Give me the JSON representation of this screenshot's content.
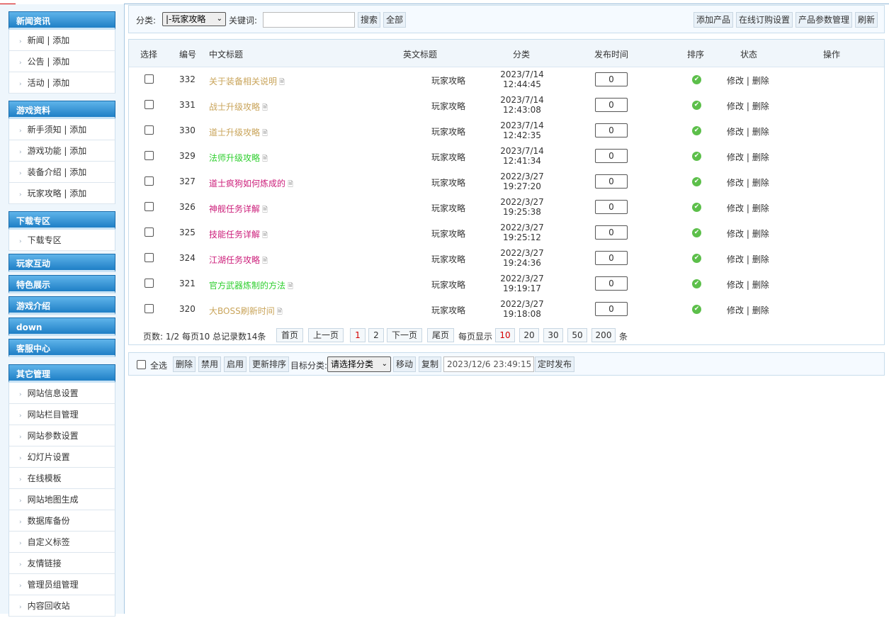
{
  "sidebar": {
    "groups": [
      {
        "title": "新闻资讯",
        "items": [
          "新闻 | 添加",
          "公告 | 添加",
          "活动 | 添加"
        ]
      },
      {
        "title": "游戏资料",
        "items": [
          "新手须知 | 添加",
          "游戏功能 | 添加",
          "装备介绍 | 添加",
          "玩家攻略 | 添加"
        ]
      },
      {
        "title": "下载专区",
        "items": [
          "下载专区"
        ]
      },
      {
        "title": "玩家互动",
        "items": []
      },
      {
        "title": "特色展示",
        "items": []
      },
      {
        "title": "游戏介绍",
        "items": []
      },
      {
        "title": "down",
        "items": []
      },
      {
        "title": "客服中心",
        "items": []
      },
      {
        "title": "其它管理",
        "items": [
          "网站信息设置",
          "网站栏目管理",
          "网站参数设置",
          "幻灯片设置",
          "在线模板",
          "网站地图生成",
          "数据库备份",
          "自定义标签",
          "友情链接",
          "管理员组管理",
          "内容回收站"
        ]
      }
    ]
  },
  "toolbar": {
    "category_label": "分类:",
    "category_value": "|-玩家攻略",
    "keyword_label": "关键词:",
    "keyword_value": "",
    "search_label": "搜索",
    "all_label": "全部",
    "add_product": "添加产品",
    "online_order": "在线订购设置",
    "product_params": "产品参数管理",
    "refresh": "刷新"
  },
  "table": {
    "headers": [
      "选择",
      "编号",
      "中文标题",
      "英文标题",
      "分类",
      "发布时间",
      "排序",
      "状态",
      "操作"
    ],
    "rows": [
      {
        "id": "332",
        "title": "关于装备相关说明",
        "title_color": "#c9a45a",
        "category": "玩家攻略",
        "date": "2023/7/14",
        "time": "12:44:45",
        "order": "0",
        "edit": "修改",
        "del": "删除"
      },
      {
        "id": "331",
        "title": "战士升级攻略",
        "title_color": "#c9a45a",
        "category": "玩家攻略",
        "date": "2023/7/14",
        "time": "12:43:08",
        "order": "0",
        "edit": "修改",
        "del": "删除"
      },
      {
        "id": "330",
        "title": "道士升级攻略",
        "title_color": "#c9a45a",
        "category": "玩家攻略",
        "date": "2023/7/14",
        "time": "12:42:35",
        "order": "0",
        "edit": "修改",
        "del": "删除"
      },
      {
        "id": "329",
        "title": "法师升级攻略",
        "title_color": "#2fcf2f",
        "category": "玩家攻略",
        "date": "2023/7/14",
        "time": "12:41:34",
        "order": "0",
        "edit": "修改",
        "del": "删除"
      },
      {
        "id": "327",
        "title": "道士疯狗如何炼成的",
        "title_color": "#cc1e7a",
        "category": "玩家攻略",
        "date": "2022/3/27",
        "time": "19:27:20",
        "order": "0",
        "edit": "修改",
        "del": "删除"
      },
      {
        "id": "326",
        "title": "神舰任务详解",
        "title_color": "#cc1e7a",
        "category": "玩家攻略",
        "date": "2022/3/27",
        "time": "19:25:38",
        "order": "0",
        "edit": "修改",
        "del": "删除"
      },
      {
        "id": "325",
        "title": "技能任务详解",
        "title_color": "#cc1e7a",
        "category": "玩家攻略",
        "date": "2022/3/27",
        "time": "19:25:12",
        "order": "0",
        "edit": "修改",
        "del": "删除"
      },
      {
        "id": "324",
        "title": "江湖任务攻略",
        "title_color": "#cc1e7a",
        "category": "玩家攻略",
        "date": "2022/3/27",
        "time": "19:24:36",
        "order": "0",
        "edit": "修改",
        "del": "删除"
      },
      {
        "id": "321",
        "title": "官方武器炼制的方法",
        "title_color": "#2fcf2f",
        "category": "玩家攻略",
        "date": "2022/3/27",
        "time": "19:19:17",
        "order": "0",
        "edit": "修改",
        "del": "删除"
      },
      {
        "id": "320",
        "title": "大BOSS刷新时间",
        "title_color": "#c9a45a",
        "category": "玩家攻略",
        "date": "2022/3/27",
        "time": "19:18:08",
        "order": "0",
        "edit": "修改",
        "del": "删除"
      }
    ]
  },
  "pager": {
    "summary": "页数: 1/2 每页10 总记录数14条",
    "first": "首页",
    "prev": "上一页",
    "pages": [
      "1",
      "2"
    ],
    "current": "1",
    "next": "下一页",
    "last": "尾页",
    "per_page_label": "每页显示",
    "sizes": [
      "10",
      "20",
      "30",
      "50",
      "200"
    ],
    "current_size": "10",
    "unit": "条"
  },
  "bottom": {
    "select_all": "全选",
    "delete": "删除",
    "disable": "禁用",
    "enable": "启用",
    "update_order": "更新排序",
    "target_label": "目标分类:",
    "target_value": "请选择分类",
    "move": "移动",
    "copy": "复制",
    "datetime": "2023/12/6 23:49:15",
    "schedule": "定时发布"
  }
}
